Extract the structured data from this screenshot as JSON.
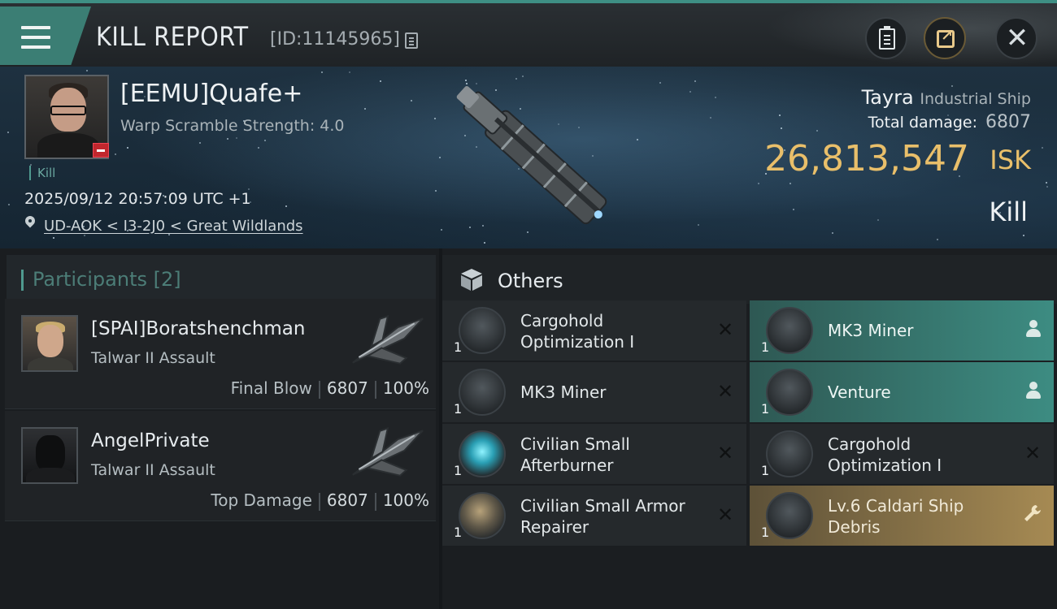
{
  "header": {
    "title": "KILL REPORT",
    "report_id": "[ID:11145965]"
  },
  "victim": {
    "name": "[EEMU]Quafe+",
    "warp_scramble": "Warp Scramble Strength: 4.0",
    "tag": "Kill",
    "datetime": "2025/09/12 20:57:09 UTC +1",
    "location": "UD-AOK < I3-2J0 < Great Wildlands",
    "ship_name": "Tayra",
    "ship_class": "Industrial Ship",
    "total_damage_label": "Total damage:",
    "total_damage": "6807",
    "isk_value": "26,813,547",
    "isk_unit": "ISK",
    "result": "Kill"
  },
  "participants": {
    "title": "Participants",
    "count": "[2]",
    "items": [
      {
        "name": "[SPAI]Boratshenchman",
        "ship": "Talwar II Assault",
        "role": "Final Blow",
        "damage": "6807",
        "percent": "100%"
      },
      {
        "name": "AngelPrivate",
        "ship": "Talwar II Assault",
        "role": "Top Damage",
        "damage": "6807",
        "percent": "100%"
      }
    ]
  },
  "others": {
    "title": "Others",
    "items": [
      {
        "name": "Cargohold Optimization I",
        "qty": "1",
        "status": "destroyed"
      },
      {
        "name": "MK3 Miner",
        "qty": "1",
        "status": "dropped"
      },
      {
        "name": "MK3 Miner",
        "qty": "1",
        "status": "destroyed"
      },
      {
        "name": "Venture",
        "qty": "1",
        "status": "dropped"
      },
      {
        "name": "Civilian Small Afterburner",
        "qty": "1",
        "status": "destroyed"
      },
      {
        "name": "Cargohold Optimization I",
        "qty": "1",
        "status": "destroyed"
      },
      {
        "name": "Civilian Small Armor Repairer",
        "qty": "1",
        "status": "destroyed"
      },
      {
        "name": "Lv.6 Caldari Ship Debris",
        "qty": "1",
        "status": "salvage"
      }
    ]
  },
  "icons": {
    "menu": "hamburger-menu-icon",
    "copy": "copy-icon",
    "clipboard": "clipboard-icon",
    "share": "share-icon",
    "close": "close-icon",
    "location": "location-pin-icon",
    "destroyed": "x-icon",
    "dropped": "person-icon",
    "salvage": "wrench-icon"
  },
  "colors": {
    "accent_teal": "#3d8c82",
    "isk_gold": "#e9bf6a",
    "salvage_gold": "#a68a53"
  }
}
